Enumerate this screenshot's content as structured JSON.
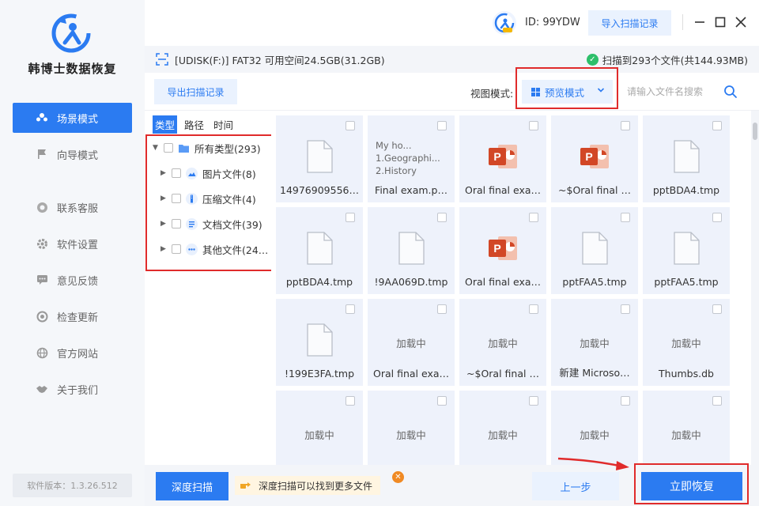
{
  "sidebar": {
    "brand": "韩博士数据恢复",
    "items": [
      {
        "label": "场景模式",
        "icon": "users-icon"
      },
      {
        "label": "向导模式",
        "icon": "flag-icon"
      },
      {
        "label": "联系客服",
        "icon": "headset-icon"
      },
      {
        "label": "软件设置",
        "icon": "gear-icon"
      },
      {
        "label": "意见反馈",
        "icon": "chat-icon"
      },
      {
        "label": "检查更新",
        "icon": "update-icon"
      },
      {
        "label": "官方网站",
        "icon": "globe-icon"
      },
      {
        "label": "关于我们",
        "icon": "handshake-icon"
      }
    ],
    "version": "软件版本：1.3.26.512"
  },
  "header": {
    "user_id": "ID: 99YDW",
    "import_label": "导入扫描记录"
  },
  "info": {
    "drive": "[UDISK(F:)] FAT32 可用空间24.5GB(31.2GB)",
    "scan_result": "扫描到293个文件(共144.93MB)"
  },
  "toolbar": {
    "export_label": "导出扫描记录",
    "view_label": "视图模式:",
    "view_value": "预览模式",
    "search_placeholder": "请输入文件名搜索"
  },
  "tree": {
    "tabs": [
      "类型",
      "路径",
      "时间"
    ],
    "root": "所有类型(293)",
    "children": [
      {
        "label": "图片文件(8)",
        "icon": "image-icon"
      },
      {
        "label": "压缩文件(4)",
        "icon": "archive-icon"
      },
      {
        "label": "文档文件(39)",
        "icon": "document-icon"
      },
      {
        "label": "其他文件(24…",
        "icon": "more-icon"
      }
    ]
  },
  "files": [
    {
      "name": "14976909556…",
      "kind": "file"
    },
    {
      "name": "Final exam.p…",
      "kind": "text",
      "preview": "My ho...\n1.Geographi...\n2.History"
    },
    {
      "name": "Oral final exa…",
      "kind": "ppt"
    },
    {
      "name": "~$Oral final …",
      "kind": "ppt"
    },
    {
      "name": "pptBDA4.tmp",
      "kind": "file"
    },
    {
      "name": "pptBDA4.tmp",
      "kind": "file"
    },
    {
      "name": "!9AA069D.tmp",
      "kind": "file"
    },
    {
      "name": "Oral final exa…",
      "kind": "ppt"
    },
    {
      "name": "pptFAA5.tmp",
      "kind": "file"
    },
    {
      "name": "pptFAA5.tmp",
      "kind": "file"
    },
    {
      "name": "!199E3FA.tmp",
      "kind": "file"
    },
    {
      "name": "Oral final exa…",
      "kind": "loading"
    },
    {
      "name": "~$Oral final …",
      "kind": "loading"
    },
    {
      "name": "新建 Microso…",
      "kind": "loading"
    },
    {
      "name": "Thumbs.db",
      "kind": "loading"
    },
    {
      "name": "",
      "kind": "loading"
    },
    {
      "name": "",
      "kind": "loading"
    },
    {
      "name": "",
      "kind": "loading"
    },
    {
      "name": "",
      "kind": "loading"
    },
    {
      "name": "",
      "kind": "loading"
    }
  ],
  "loading_text": "加载中",
  "ppt_letter": "P",
  "bottom": {
    "deep_scan_label": "深度扫描",
    "tip": "深度扫描可以找到更多文件",
    "prev_label": "上一步",
    "recover_label": "立即恢复"
  },
  "colors": {
    "accent": "#2b7bf1",
    "highlight": "#e02b2b",
    "ppt": "#d24726"
  }
}
